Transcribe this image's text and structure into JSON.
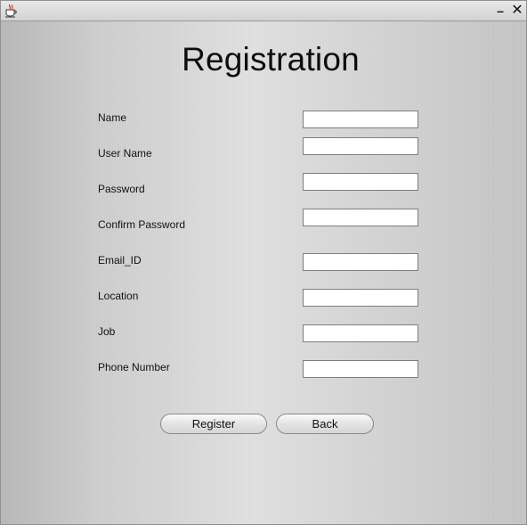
{
  "window": {
    "title": "",
    "minimize_glyph": "–",
    "close_glyph": "✕"
  },
  "page_title": "Registration",
  "fields": [
    {
      "label": "Name",
      "value": ""
    },
    {
      "label": "User Name",
      "value": ""
    },
    {
      "label": "Password",
      "value": ""
    },
    {
      "label": "Confirm Password",
      "value": ""
    },
    {
      "label": "Email_ID",
      "value": ""
    },
    {
      "label": "Location",
      "value": ""
    },
    {
      "label": "Job",
      "value": ""
    },
    {
      "label": "Phone Number",
      "value": ""
    }
  ],
  "buttons": {
    "register": "Register",
    "back": "Back"
  }
}
